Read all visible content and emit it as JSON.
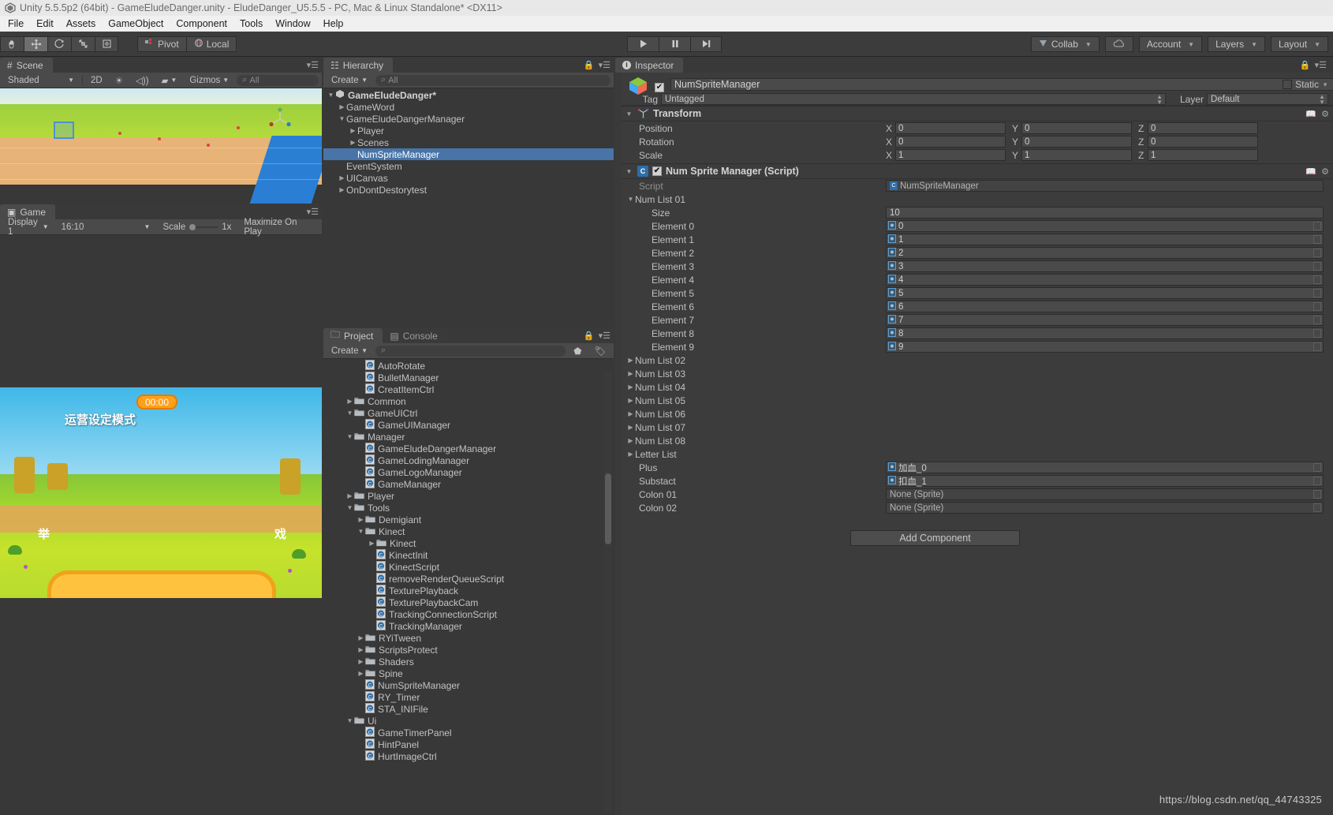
{
  "window": {
    "title": "Unity 5.5.5p2 (64bit) - GameEludeDanger.unity - EludeDanger_U5.5.5 - PC, Mac & Linux Standalone* <DX11>",
    "logo_icon": "unity-logo-icon"
  },
  "menu": {
    "items": [
      "File",
      "Edit",
      "Assets",
      "GameObject",
      "Component",
      "Tools",
      "Window",
      "Help"
    ]
  },
  "toolbar": {
    "transform_tools": [
      {
        "name": "hand-tool",
        "icon": "hand-icon",
        "active": false
      },
      {
        "name": "move-tool",
        "icon": "move-icon",
        "active": true
      },
      {
        "name": "rotate-tool",
        "icon": "rotate-icon",
        "active": false
      },
      {
        "name": "scale-tool",
        "icon": "scale-icon",
        "active": false
      },
      {
        "name": "rect-tool",
        "icon": "rect-transform-icon",
        "active": false
      }
    ],
    "pivot_label": "Pivot",
    "pivot_icon": "pivot-icon",
    "local_label": "Local",
    "local_icon": "local-icon",
    "play_label": "play-icon",
    "pause_label": "pause-icon",
    "step_label": "step-icon",
    "collab_label": "Collab",
    "collab_icon": "collab-icon",
    "cloud_icon": "cloud-icon",
    "account_label": "Account",
    "layers_label": "Layers",
    "layout_label": "Layout"
  },
  "scene_view": {
    "tab_label": "Scene",
    "tab_icon": "scene-icon",
    "shading_mode": "Shaded",
    "mode_2d": "2D",
    "lighting_icon": "lighting-icon",
    "audio_icon": "audio-icon",
    "effects_icon": "effects-icon",
    "gizmos_label": "Gizmos",
    "search_placeholder": "All"
  },
  "game_view": {
    "tab_label": "Game",
    "tab_icon": "game-icon",
    "display_label": "Display 1",
    "aspect_label": "16:10",
    "scale_label": "Scale",
    "scale_value": "1x",
    "maximize_label": "Maximize On Play",
    "timer_text": "00:00",
    "title_cn": "运营设定模式",
    "left_cn": "举",
    "right_cn": "戏"
  },
  "hierarchy": {
    "tab_label": "Hierarchy",
    "tab_icon": "hierarchy-icon",
    "create_label": "Create",
    "search_placeholder": "All",
    "items": [
      {
        "label": "GameEludeDanger*",
        "depth": 0,
        "twisty": "down",
        "root": true,
        "selected": false,
        "icon": "unity-scene-icon"
      },
      {
        "label": "GameWord",
        "depth": 1,
        "twisty": "right",
        "selected": false
      },
      {
        "label": "GameEludeDangerManager",
        "depth": 1,
        "twisty": "down",
        "selected": false
      },
      {
        "label": "Player",
        "depth": 2,
        "twisty": "right",
        "selected": false
      },
      {
        "label": "Scenes",
        "depth": 2,
        "twisty": "right",
        "selected": false
      },
      {
        "label": "NumSpriteManager",
        "depth": 2,
        "twisty": "none",
        "selected": true
      },
      {
        "label": "EventSystem",
        "depth": 1,
        "twisty": "none",
        "selected": false
      },
      {
        "label": "UICanvas",
        "depth": 1,
        "twisty": "right",
        "selected": false
      },
      {
        "label": "OnDontDestorytest",
        "depth": 1,
        "twisty": "right",
        "selected": false
      }
    ]
  },
  "project": {
    "tab_label": "Project",
    "tab_icon": "folder-icon",
    "console_tab_label": "Console",
    "console_tab_icon": "console-icon",
    "create_label": "Create",
    "search_placeholder": "",
    "items": [
      {
        "label": "AutoRotate",
        "depth": 3,
        "twisty": "none",
        "type": "script"
      },
      {
        "label": "BulletManager",
        "depth": 3,
        "twisty": "none",
        "type": "script"
      },
      {
        "label": "CreatItemCtrl",
        "depth": 3,
        "twisty": "none",
        "type": "script"
      },
      {
        "label": "Common",
        "depth": 2,
        "twisty": "right",
        "type": "folder"
      },
      {
        "label": "GameUICtrl",
        "depth": 2,
        "twisty": "down",
        "type": "folder"
      },
      {
        "label": "GameUIManager",
        "depth": 3,
        "twisty": "none",
        "type": "script"
      },
      {
        "label": "Manager",
        "depth": 2,
        "twisty": "down",
        "type": "folder"
      },
      {
        "label": "GameEludeDangerManager",
        "depth": 3,
        "twisty": "none",
        "type": "script"
      },
      {
        "label": "GameLodingManager",
        "depth": 3,
        "twisty": "none",
        "type": "script"
      },
      {
        "label": "GameLogoManager",
        "depth": 3,
        "twisty": "none",
        "type": "script"
      },
      {
        "label": "GameManager",
        "depth": 3,
        "twisty": "none",
        "type": "script"
      },
      {
        "label": "Player",
        "depth": 2,
        "twisty": "right",
        "type": "folder"
      },
      {
        "label": "Tools",
        "depth": 2,
        "twisty": "down",
        "type": "folder"
      },
      {
        "label": "Demigiant",
        "depth": 3,
        "twisty": "right",
        "type": "folder"
      },
      {
        "label": "Kinect",
        "depth": 3,
        "twisty": "down",
        "type": "folder"
      },
      {
        "label": "Kinect",
        "depth": 4,
        "twisty": "right",
        "type": "folder"
      },
      {
        "label": "KinectInit",
        "depth": 4,
        "twisty": "none",
        "type": "script"
      },
      {
        "label": "KinectScript",
        "depth": 4,
        "twisty": "none",
        "type": "script"
      },
      {
        "label": "removeRenderQueueScript",
        "depth": 4,
        "twisty": "none",
        "type": "script"
      },
      {
        "label": "TexturePlayback",
        "depth": 4,
        "twisty": "none",
        "type": "script"
      },
      {
        "label": "TexturePlaybackCam",
        "depth": 4,
        "twisty": "none",
        "type": "script"
      },
      {
        "label": "TrackingConnectionScript",
        "depth": 4,
        "twisty": "none",
        "type": "script"
      },
      {
        "label": "TrackingManager",
        "depth": 4,
        "twisty": "none",
        "type": "script"
      },
      {
        "label": "RYiTween",
        "depth": 3,
        "twisty": "right",
        "type": "folder"
      },
      {
        "label": "ScriptsProtect",
        "depth": 3,
        "twisty": "right",
        "type": "folder"
      },
      {
        "label": "Shaders",
        "depth": 3,
        "twisty": "right",
        "type": "folder"
      },
      {
        "label": "Spine",
        "depth": 3,
        "twisty": "right",
        "type": "folder"
      },
      {
        "label": "NumSpriteManager",
        "depth": 3,
        "twisty": "none",
        "type": "script"
      },
      {
        "label": "RY_Timer",
        "depth": 3,
        "twisty": "none",
        "type": "script"
      },
      {
        "label": "STA_INIFile",
        "depth": 3,
        "twisty": "none",
        "type": "script"
      },
      {
        "label": "Ui",
        "depth": 2,
        "twisty": "down",
        "type": "folder"
      },
      {
        "label": "GameTimerPanel",
        "depth": 3,
        "twisty": "none",
        "type": "script"
      },
      {
        "label": "HintPanel",
        "depth": 3,
        "twisty": "none",
        "type": "script"
      },
      {
        "label": "HurtImageCtrl",
        "depth": 3,
        "twisty": "none",
        "type": "script"
      }
    ]
  },
  "inspector": {
    "tab_label": "Inspector",
    "tab_icon": "info-icon",
    "object_name": "NumSpriteManager",
    "object_enabled": true,
    "object_icon": "gameobject-cube-icon",
    "static_label": "Static",
    "tag_label": "Tag",
    "tag_value": "Untagged",
    "layer_label": "Layer",
    "layer_value": "Default",
    "transform": {
      "title": "Transform",
      "icon": "transform-icon",
      "rows": [
        {
          "label": "Position",
          "x": "0",
          "y": "0",
          "z": "0"
        },
        {
          "label": "Rotation",
          "x": "0",
          "y": "0",
          "z": "0"
        },
        {
          "label": "Scale",
          "x": "1",
          "y": "1",
          "z": "1"
        }
      ]
    },
    "script_component": {
      "title": "Num Sprite Manager (Script)",
      "enabled": true,
      "icon": "csharp-script-icon",
      "script_label": "Script",
      "script_value": "NumSpriteManager",
      "num_list_01": {
        "label": "Num List 01",
        "expanded": true,
        "size_label": "Size",
        "size_value": "10",
        "elements": [
          {
            "label": "Element 0",
            "value": "0"
          },
          {
            "label": "Element 1",
            "value": "1"
          },
          {
            "label": "Element 2",
            "value": "2"
          },
          {
            "label": "Element 3",
            "value": "3"
          },
          {
            "label": "Element 4",
            "value": "4"
          },
          {
            "label": "Element 5",
            "value": "5"
          },
          {
            "label": "Element 6",
            "value": "6"
          },
          {
            "label": "Element 7",
            "value": "7"
          },
          {
            "label": "Element 8",
            "value": "8"
          },
          {
            "label": "Element 9",
            "value": "9"
          }
        ]
      },
      "collapsed_lists": [
        "Num List 02",
        "Num List 03",
        "Num List 04",
        "Num List 05",
        "Num List 06",
        "Num List 07",
        "Num List 08",
        "Letter List"
      ],
      "sprite_fields": [
        {
          "label": "Plus",
          "value": "加血_0",
          "empty": false
        },
        {
          "label": "Substact",
          "value": "扣血_1",
          "empty": false
        },
        {
          "label": "Colon 01",
          "value": "None (Sprite)",
          "empty": true
        },
        {
          "label": "Colon 02",
          "value": "None (Sprite)",
          "empty": true
        }
      ]
    },
    "add_component_label": "Add Component"
  },
  "watermark": "https://blog.csdn.net/qq_44743325"
}
